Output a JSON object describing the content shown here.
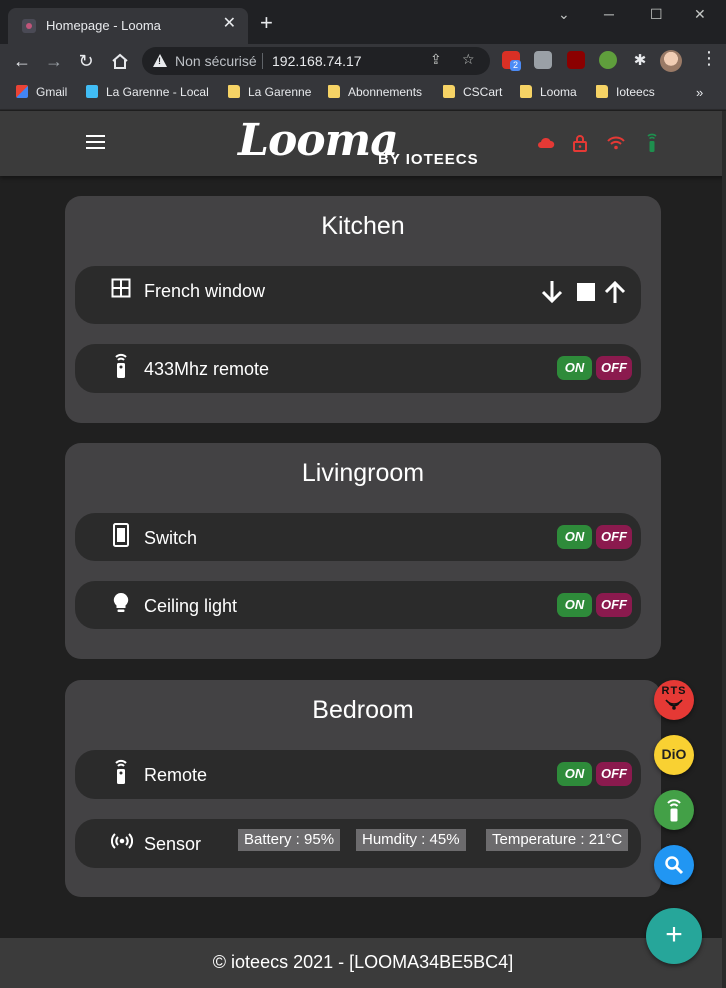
{
  "browser": {
    "tab_title": "Homepage - Looma",
    "tab_close": "✕",
    "new_tab": "+",
    "omnibox": {
      "security_label": "Non sécurisé",
      "url": "192.168.74.17"
    },
    "extension_badge": "2",
    "bookmarks": [
      {
        "label": "Gmail",
        "icon": "gmail-icon"
      },
      {
        "label": "La Garenne - Local",
        "icon": "home-icon"
      },
      {
        "label": "La Garenne",
        "icon": "folder-icon"
      },
      {
        "label": "Abonnements",
        "icon": "folder-icon"
      },
      {
        "label": "CSCart",
        "icon": "folder-icon"
      },
      {
        "label": "Looma",
        "icon": "folder-icon"
      },
      {
        "label": "Ioteecs",
        "icon": "folder-icon"
      }
    ],
    "bookmarks_more": "»"
  },
  "app": {
    "logo": "Looma",
    "logo_sub": "BY IOTEECS",
    "status_icons": [
      "cloud-icon",
      "lock-icon",
      "wifi-icon",
      "remote-icon"
    ],
    "colors": {
      "status_red": "#e53935",
      "status_green": "#1e8f4e",
      "on": "#2e8b3a",
      "off": "#8b1a4e",
      "card": "#434244",
      "row": "#2b2b2b"
    }
  },
  "rooms": [
    {
      "name": "Kitchen",
      "devices": [
        {
          "label": "French window",
          "icon": "window-icon",
          "controls": "shutter"
        },
        {
          "label": "433Mhz remote",
          "icon": "remote-icon",
          "on": "ON",
          "off": "OFF"
        }
      ]
    },
    {
      "name": "Livingroom",
      "devices": [
        {
          "label": "Switch",
          "icon": "switch-icon",
          "on": "ON",
          "off": "OFF"
        },
        {
          "label": "Ceiling light",
          "icon": "bulb-icon",
          "on": "ON",
          "off": "OFF"
        }
      ]
    },
    {
      "name": "Bedroom",
      "devices": [
        {
          "label": "Remote",
          "icon": "remote-icon",
          "on": "ON",
          "off": "OFF"
        },
        {
          "label": "Sensor",
          "icon": "sensor-icon",
          "readings": [
            "Battery : 95%",
            "Humdity : 45%",
            "Temperature : 21°C"
          ]
        }
      ]
    }
  ],
  "fabs": {
    "rts": "RTS",
    "dio": "DiO",
    "remote": "remote-icon",
    "search": "search-icon",
    "add": "+"
  },
  "footer": "© ioteecs 2021 - [LOOMA34BE5BC4]"
}
